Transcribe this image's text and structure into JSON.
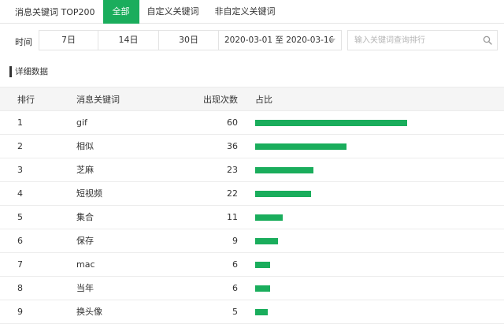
{
  "tabs": {
    "title": "消息关键词 TOP200",
    "items": [
      "全部",
      "自定义关键词",
      "非自定义关键词"
    ],
    "active": 0
  },
  "filter": {
    "label": "时间",
    "ranges": [
      "7日",
      "14日",
      "30日"
    ],
    "date_range": "2020-03-01 至 2020-03-16",
    "search_placeholder": "输入关键词查询排行"
  },
  "section_title": "详细数据",
  "table": {
    "headers": {
      "rank": "排行",
      "keyword": "消息关键词",
      "count": "出现次数",
      "ratio": "占比"
    },
    "max_count": 60,
    "rows": [
      {
        "rank": "1",
        "keyword": "gif",
        "count": "60",
        "value": 60
      },
      {
        "rank": "2",
        "keyword": "相似",
        "count": "36",
        "value": 36
      },
      {
        "rank": "3",
        "keyword": "芝麻",
        "count": "23",
        "value": 23
      },
      {
        "rank": "4",
        "keyword": "短视频",
        "count": "22",
        "value": 22
      },
      {
        "rank": "5",
        "keyword": "集合",
        "count": "11",
        "value": 11
      },
      {
        "rank": "6",
        "keyword": "保存",
        "count": "9",
        "value": 9
      },
      {
        "rank": "7",
        "keyword": "mac",
        "count": "6",
        "value": 6
      },
      {
        "rank": "8",
        "keyword": "当年",
        "count": "6",
        "value": 6
      },
      {
        "rank": "9",
        "keyword": "换头像",
        "count": "5",
        "value": 5
      }
    ]
  },
  "colors": {
    "accent": "#1aad5c"
  },
  "icons": {
    "search": "search-icon",
    "dropdown": "chevron-down-icon"
  }
}
